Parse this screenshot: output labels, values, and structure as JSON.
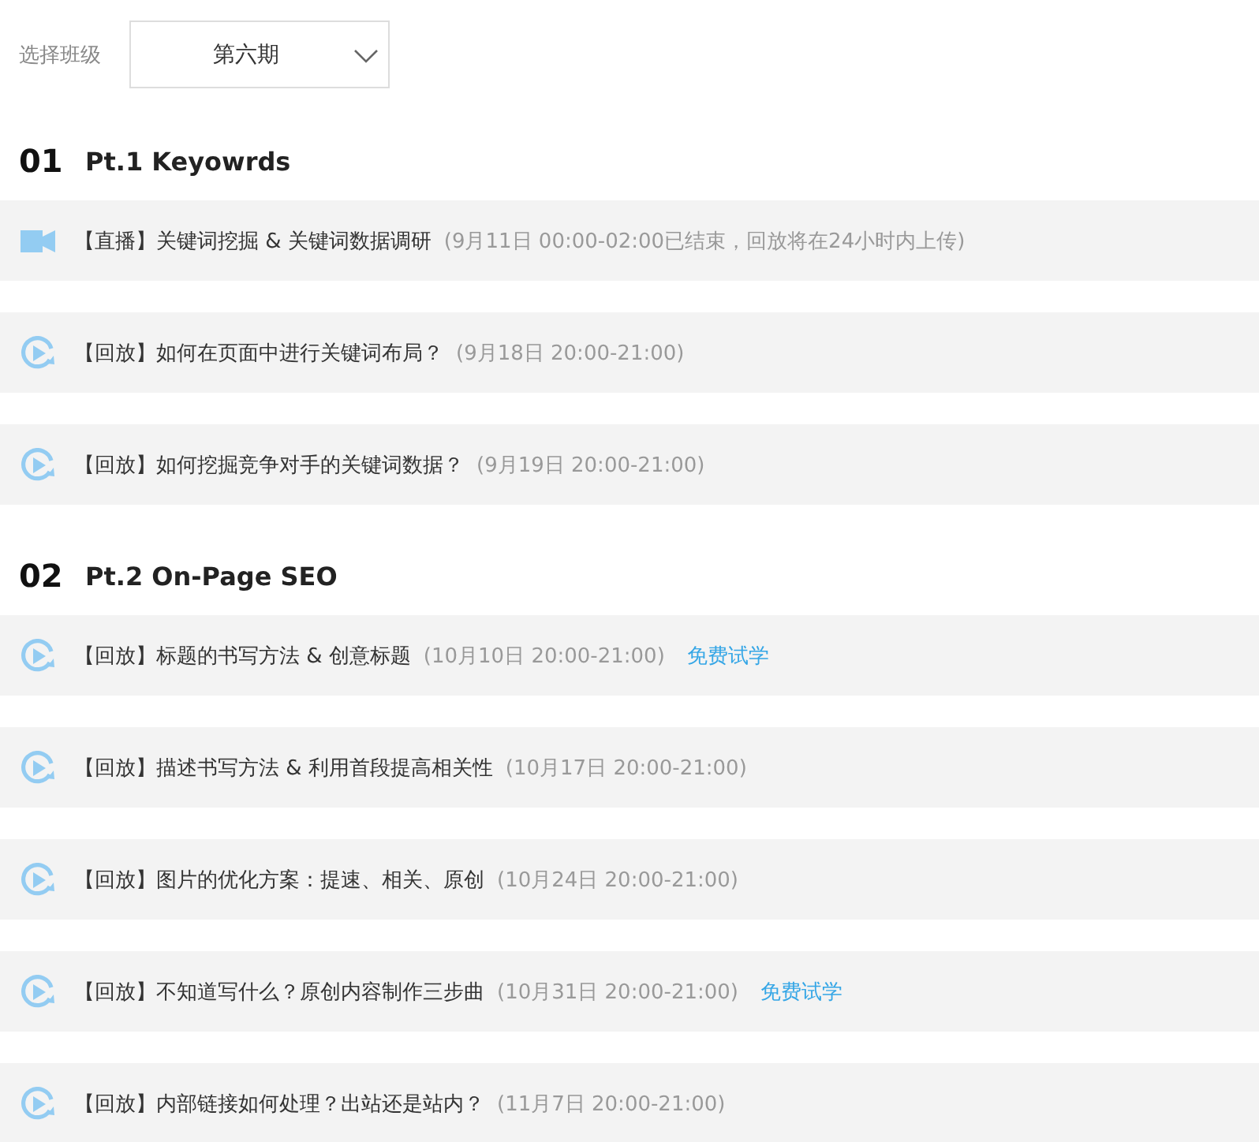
{
  "class_select": {
    "label": "选择班级",
    "value": "第六期"
  },
  "sections": [
    {
      "number": "01",
      "title": "Pt.1 Keyowrds",
      "lessons": [
        {
          "kind": "live",
          "title": "【直播】关键词挖掘 & 关键词数据调研",
          "time": "(9月11日 00:00-02:00已结束，回放将在24小时内上传)"
        },
        {
          "kind": "replay",
          "title": "【回放】如何在页面中进行关键词布局？",
          "time": "(9月18日 20:00-21:00)"
        },
        {
          "kind": "replay",
          "title": "【回放】如何挖掘竞争对手的关键词数据？",
          "time": "(9月19日 20:00-21:00)"
        }
      ]
    },
    {
      "number": "02",
      "title": "Pt.2 On-Page SEO",
      "lessons": [
        {
          "kind": "replay",
          "title": "【回放】标题的书写方法 & 创意标题",
          "time": "(10月10日 20:00-21:00)",
          "free_trial": "免费试学"
        },
        {
          "kind": "replay",
          "title": "【回放】描述书写方法 & 利用首段提高相关性",
          "time": "(10月17日 20:00-21:00)"
        },
        {
          "kind": "replay",
          "title": "【回放】图片的优化方案：提速、相关、原创",
          "time": "(10月24日 20:00-21:00)"
        },
        {
          "kind": "replay",
          "title": "【回放】不知道写什么？原创内容制作三步曲",
          "time": "(10月31日 20:00-21:00)",
          "free_trial": "免费试学"
        },
        {
          "kind": "replay",
          "title": "【回放】内部链接如何处理？出站还是站内？",
          "time": "(11月7日 20:00-21:00)"
        }
      ]
    }
  ]
}
